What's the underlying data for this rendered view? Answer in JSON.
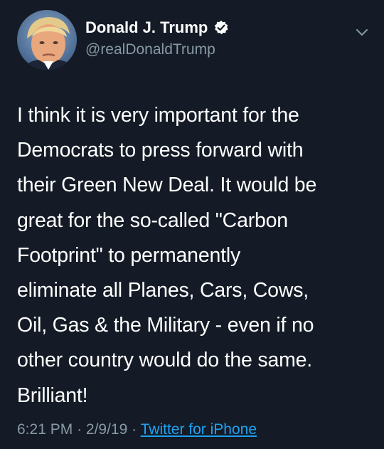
{
  "author": {
    "display_name": "Donald J. Trump",
    "handle": "@realDonaldTrump",
    "verified": true,
    "verified_icon": "verified-badge-icon",
    "avatar_icon": "profile-avatar"
  },
  "menu_icon": "chevron-down-icon",
  "tweet": {
    "text": "I think it is very important for the\nDemocrats to press forward with\ntheir Green New Deal. It would be\ngreat for the so-called \"Carbon\nFootprint\" to permanently\neliminate all Planes, Cars, Cows,\nOil, Gas & the Military - even if no\nother country would do the same.\nBrilliant!",
    "time": "6:21 PM",
    "date": "2/9/19",
    "separator": "·",
    "source": "Twitter for iPhone"
  },
  "colors": {
    "background": "#141b26",
    "text": "#ffffff",
    "secondary_text": "#8899a6",
    "link": "#1da1f2"
  }
}
